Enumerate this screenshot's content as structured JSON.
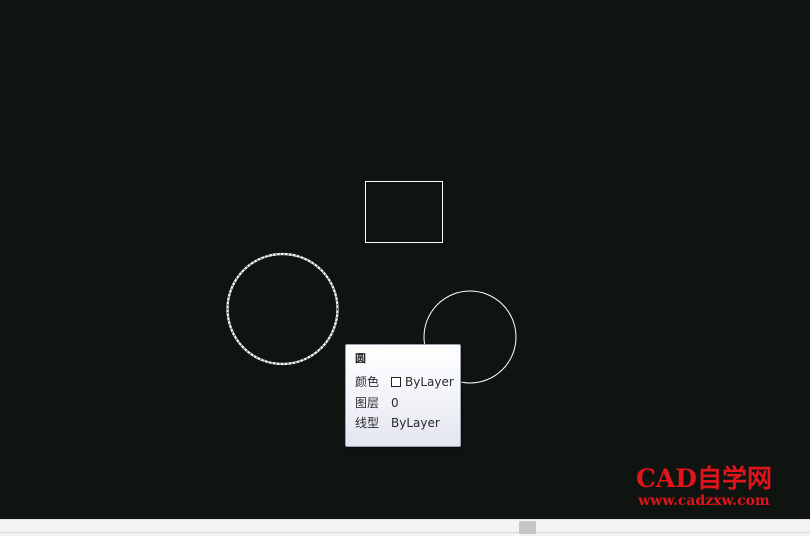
{
  "tooltip": {
    "title": "圆",
    "rows": [
      {
        "label": "颜色",
        "value": "ByLayer",
        "swatch": "#ffffff"
      },
      {
        "label": "图层",
        "value": "0"
      },
      {
        "label": "线型",
        "value": "ByLayer"
      }
    ]
  },
  "watermark": {
    "main": "CAD自学网",
    "sub": "www.cadzxw.com"
  },
  "colors": {
    "background": "#0f1411",
    "entity": "#ffffff",
    "watermark": "#e0141a"
  },
  "entities": [
    {
      "type": "rectangle",
      "state": "normal"
    },
    {
      "type": "circle",
      "state": "highlighted"
    },
    {
      "type": "circle",
      "state": "normal"
    }
  ]
}
